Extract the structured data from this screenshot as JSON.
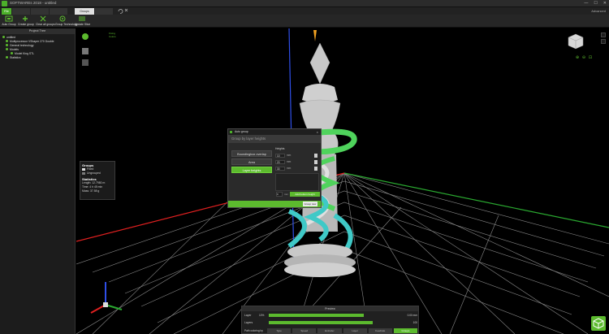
{
  "window": {
    "title": "SOFTWAREs 2018 - untitled",
    "controls": [
      "—",
      "☐",
      "✕"
    ]
  },
  "tabs": [
    {
      "label": "File",
      "kind": "file"
    },
    {
      "label": "",
      "kind": "normal"
    },
    {
      "label": "",
      "kind": "normal"
    },
    {
      "label": "",
      "kind": "normal"
    },
    {
      "label": "Groups",
      "kind": "active"
    },
    {
      "label": "",
      "kind": "normal"
    }
  ],
  "advanced_label": "Advanced",
  "ribbon": [
    {
      "label": "Auto Group",
      "icon": "auto-group-icon"
    },
    {
      "label": "Create group",
      "icon": "create-group-icon"
    },
    {
      "label": "Clear all groups",
      "icon": "clear-groups-icon"
    },
    {
      "label": "Group Technology",
      "icon": "group-technology-icon"
    },
    {
      "label": "Update Slice",
      "icon": "update-slice-icon"
    }
  ],
  "project_tree": {
    "header": "Project Tree",
    "items": [
      {
        "label": "untitled",
        "indent": 0
      },
      {
        "label": "Multiprocessor VShaper 270 Double",
        "indent": 1
      },
      {
        "label": "General technology",
        "indent": 1
      },
      {
        "label": "Models",
        "indent": 1
      },
      {
        "label": "Model King STL",
        "indent": 2
      },
      {
        "label": "Statistics",
        "indent": 1
      }
    ]
  },
  "groups_box": {
    "title": "Groups",
    "legend": [
      {
        "label": "Fixed",
        "color": "#e0e0e0"
      },
      {
        "label": "Ungrouped",
        "color": "#7a7a7a"
      }
    ],
    "stats_title": "Statistics",
    "stats": [
      {
        "label": "Length: 12.7980 m"
      },
      {
        "label": "Time: 4 h 45 min"
      },
      {
        "label": "Mass: 37.58 g"
      }
    ]
  },
  "viewport_label": {
    "line1": "Fixing",
    "line2": "Colors"
  },
  "dialog": {
    "title": "Auto group",
    "subtitle": "Group by layer heights",
    "options": [
      {
        "label": "Boundingbox overlap",
        "active": false
      },
      {
        "label": "Area",
        "active": false
      },
      {
        "label": "Layer heights",
        "active": true
      }
    ],
    "heights_label": "Heights",
    "heights": [
      {
        "value": "10",
        "unit": "mm"
      },
      {
        "value": "20",
        "unit": "mm"
      },
      {
        "value": "30",
        "unit": "mm"
      }
    ],
    "add_value": "0",
    "add_unit": "mm",
    "add_label": "Add bottom height",
    "ok_label": "Group now"
  },
  "preview": {
    "title": "Preview",
    "layer_label": "Layer",
    "layer_value": "10%",
    "layer_end": "0.00 mm",
    "layer_fill": 0.78,
    "layers_label": "Layers",
    "layers_end": "100",
    "layers_fill": 0.85,
    "mode_label": "Path coloring by",
    "modes": [
      {
        "label": "Type",
        "on": false
      },
      {
        "label": "Speed",
        "on": false
      },
      {
        "label": "Extruder",
        "on": false
      },
      {
        "label": "Layer",
        "on": false
      },
      {
        "label": "Feedrate",
        "on": false
      },
      {
        "label": "Groups",
        "on": true
      }
    ]
  },
  "colors": {
    "accent": "#5cba2e",
    "model": "#c8c8c8",
    "group_green": "#4fd35c",
    "group_cyan": "#3fc9c7",
    "grid": "#9a9a9a",
    "axis_x": "#e02020",
    "axis_y": "#2aa830",
    "axis_z": "#2f4fe8"
  }
}
